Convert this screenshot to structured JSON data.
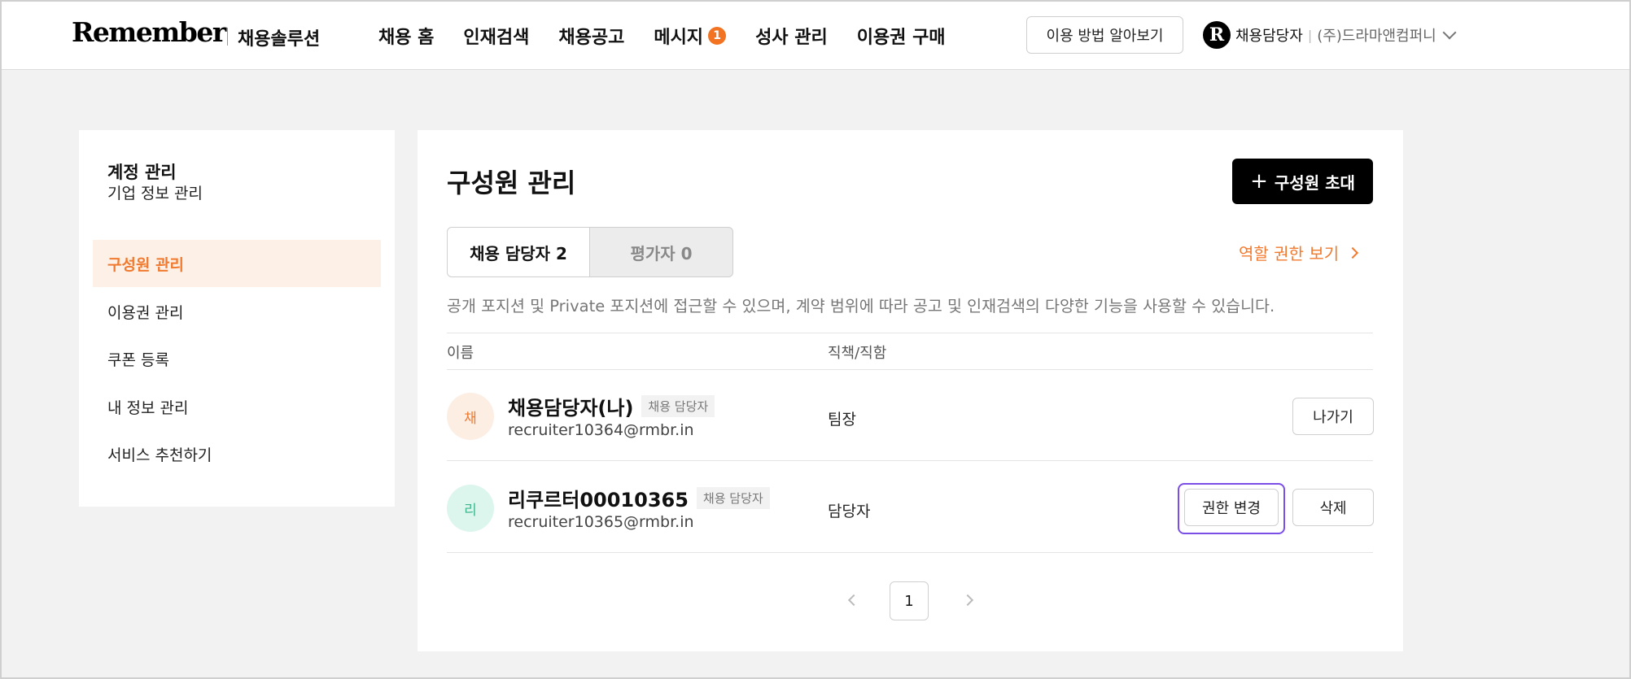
{
  "header": {
    "logo": "Remember",
    "logo_sub": "채용솔루션",
    "nav": [
      {
        "label": "채용 홈"
      },
      {
        "label": "인재검색"
      },
      {
        "label": "채용공고"
      },
      {
        "label": "메시지",
        "badge": "1"
      },
      {
        "label": "성사 관리"
      },
      {
        "label": "이용권 구매"
      }
    ],
    "how_to_label": "이용 방법 알아보기",
    "user_logo": "R",
    "user_role": "채용담당자",
    "user_company": "(주)드라마앤컴퍼니"
  },
  "sidebar": {
    "title": "계정 관리",
    "items": [
      {
        "label": "기업 정보 관리",
        "active": false
      },
      {
        "label": "구성원 관리",
        "active": true
      },
      {
        "label": "이용권 관리",
        "active": false
      },
      {
        "label": "쿠폰 등록",
        "active": false
      },
      {
        "label": "내 정보 관리",
        "active": false
      },
      {
        "label": "서비스 추천하기",
        "active": false
      }
    ]
  },
  "main": {
    "title": "구성원 관리",
    "invite_label": "구성원 초대",
    "tabs": [
      {
        "label": "채용 담당자 2",
        "active": true
      },
      {
        "label": "평가자 0",
        "active": false
      }
    ],
    "role_link": "역할 권한 보기",
    "description": "공개 포지션 및 Private 포지션에 접근할 수 있으며, 계약 범위에 따라 공고 및 인재검색의 다양한 기능을 사용할 수 있습니다.",
    "columns": {
      "name": "이름",
      "position": "직책/직함"
    },
    "rows": [
      {
        "avatar": "채",
        "name": "채용담당자(나)",
        "role_tag": "채용 담당자",
        "email": "recruiter10364@rmbr.in",
        "position": "팀장",
        "actions": [
          "나가기"
        ]
      },
      {
        "avatar": "리",
        "name": "리쿠르터00010365",
        "role_tag": "채용 담당자",
        "email": "recruiter10365@rmbr.in",
        "position": "담당자",
        "actions": [
          "권한 변경",
          "삭제"
        ]
      }
    ],
    "pagination": {
      "current": "1"
    }
  },
  "colors": {
    "accent": "#f07a2f",
    "badge": "#f27321",
    "focus": "#7b4ee6",
    "avatar1_bg": "#fdeee4",
    "avatar1_fg": "#f07a2f",
    "avatar2_bg": "#dcf6ee",
    "avatar2_fg": "#3fb58c"
  }
}
